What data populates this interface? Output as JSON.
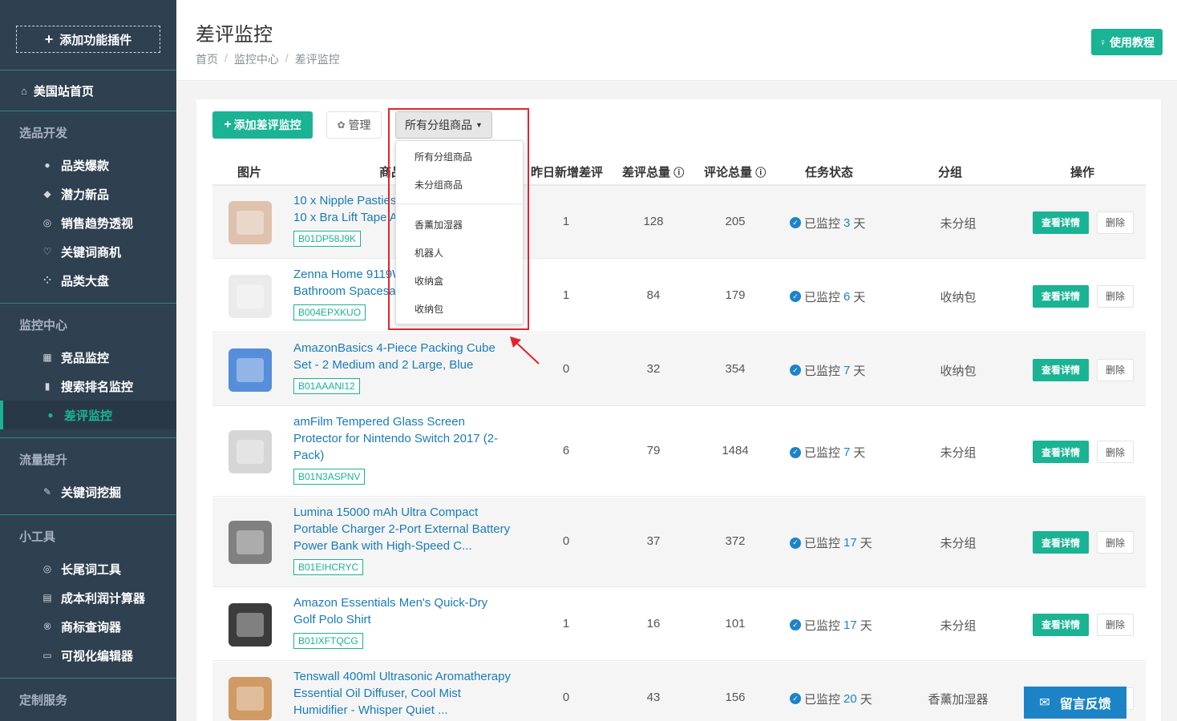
{
  "sidebar": {
    "add_plugin": "添加功能插件",
    "home": "美国站首页",
    "sections": [
      {
        "title": "选品开发",
        "items": [
          "品类爆款",
          "潜力新品",
          "销售趋势透视",
          "关键词商机",
          "品类大盘"
        ]
      },
      {
        "title": "监控中心",
        "items": [
          "竞品监控",
          "搜索排名监控",
          "差评监控"
        ]
      },
      {
        "title": "流量提升",
        "items": [
          "关键词挖掘"
        ]
      },
      {
        "title": "小工具",
        "items": [
          "长尾词工具",
          "成本利润计算器",
          "商标查询器",
          "可视化编辑器"
        ]
      },
      {
        "title": "定制服务",
        "items": []
      }
    ],
    "active_item": "差评监控"
  },
  "header": {
    "title": "差评监控",
    "breadcrumb": [
      "首页",
      "监控中心",
      "差评监控"
    ],
    "breadcrumb_sep": "/",
    "tutorial_label": "使用教程"
  },
  "toolbar": {
    "add_label": "添加差评监控",
    "manage_label": "管理",
    "group_select_label": "所有分组商品"
  },
  "dropdown": {
    "options": [
      "所有分组商品",
      "未分组商品",
      "香薰加湿器",
      "机器人",
      "收纳盒",
      "收纳包"
    ]
  },
  "table": {
    "headers": {
      "image": "图片",
      "product": "商品",
      "new_bad": "昨日新增差评",
      "bad_total": "差评总量",
      "review_total": "评论总量",
      "status": "任务状态",
      "group": "分组",
      "actions": "操作"
    },
    "status_prefix": "已监控",
    "days_unit": "天",
    "detail_label": "查看详情",
    "delete_label": "删除",
    "rows": [
      {
        "name": "10 x Nipple Pasties Adhesive Covers 10 x Bra Lift Tape A...",
        "name_visible": [
          "10 x Nipple Pasties",
          "10 x Bra Lift Tape A"
        ],
        "asin": "B01DP58J9K",
        "new_bad": "1",
        "bad_total": "128",
        "review_total": "205",
        "days": "3",
        "group": "未分组"
      },
      {
        "name": "Zenna Home 9119W Bathroom Spacesaver",
        "name_visible": [
          "Zenna Home 9119W",
          "Bathroom Spacesav"
        ],
        "asin": "B004EPXKUO",
        "new_bad": "1",
        "bad_total": "84",
        "review_total": "179",
        "days": "6",
        "group": "收纳包"
      },
      {
        "name_visible": [
          "AmazonBasics 4-Piece Packing Cube",
          "Set - 2 Medium and 2 Large, Blue"
        ],
        "asin": "B01AAANI12",
        "new_bad": "0",
        "bad_total": "32",
        "review_total": "354",
        "days": "7",
        "group": "收纳包"
      },
      {
        "name_visible": [
          "amFilm Tempered Glass Screen",
          "Protector for Nintendo Switch 2017 (2-",
          "Pack)"
        ],
        "asin": "B01N3ASPNV",
        "new_bad": "6",
        "bad_total": "79",
        "review_total": "1484",
        "days": "7",
        "group": "未分组"
      },
      {
        "name_visible": [
          "Lumina 15000 mAh Ultra Compact",
          "Portable Charger 2-Port External Battery",
          "Power Bank with High-Speed C..."
        ],
        "asin": "B01EIHCRYC",
        "new_bad": "0",
        "bad_total": "37",
        "review_total": "372",
        "days": "17",
        "group": "未分组"
      },
      {
        "name_visible": [
          "Amazon Essentials Men's Quick-Dry",
          "Golf Polo Shirt"
        ],
        "asin": "B01IXFTQCG",
        "new_bad": "1",
        "bad_total": "16",
        "review_total": "101",
        "days": "17",
        "group": "未分组"
      },
      {
        "name_visible": [
          "Tenswall 400ml Ultrasonic Aromatherapy",
          "Essential Oil Diffuser, Cool Mist",
          "Humidifier - Whisper Quiet ..."
        ],
        "asin": "",
        "new_bad": "0",
        "bad_total": "43",
        "review_total": "156",
        "days": "20",
        "group": "香薰加湿器"
      }
    ]
  },
  "feedback_label": "留言反馈",
  "colors": {
    "primary": "#1ab394",
    "link": "#1c84c6",
    "sidebar": "#2f4050",
    "highlight": "#e6232b"
  }
}
